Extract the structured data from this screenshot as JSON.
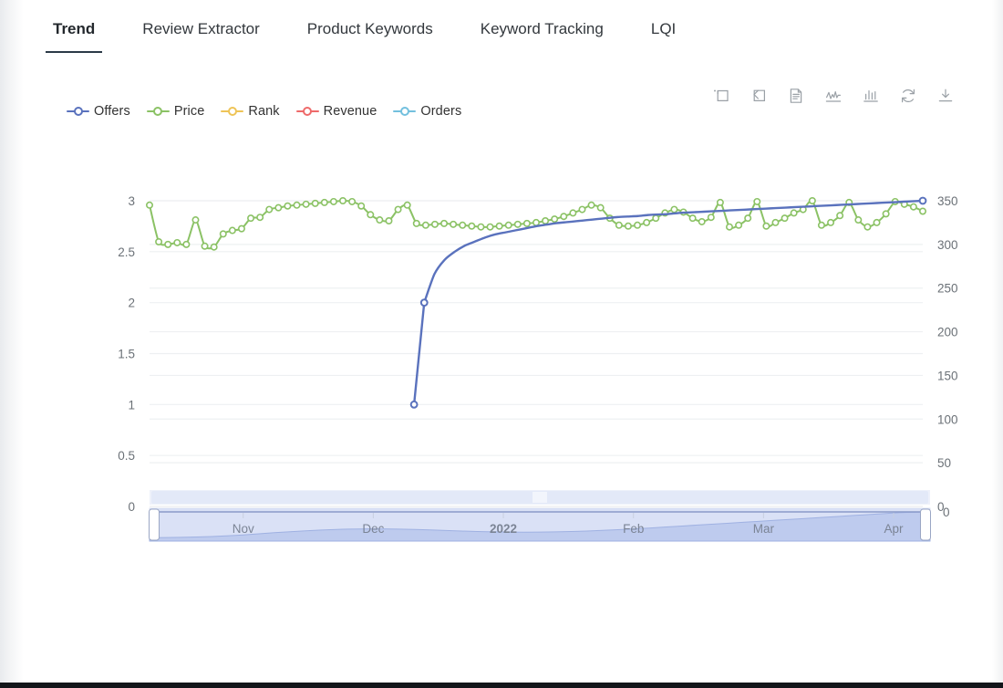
{
  "tabs": [
    {
      "label": "Trend",
      "active": true
    },
    {
      "label": "Review Extractor",
      "active": false
    },
    {
      "label": "Product Keywords",
      "active": false
    },
    {
      "label": "Keyword Tracking",
      "active": false
    },
    {
      "label": "LQI",
      "active": false
    }
  ],
  "toolbox": [
    {
      "name": "zoom-select-icon",
      "title": "Area zoom"
    },
    {
      "name": "undo-restore-icon",
      "title": "Restore zoom"
    },
    {
      "name": "data-view-icon",
      "title": "Data view"
    },
    {
      "name": "line-chart-icon",
      "title": "Switch to line chart"
    },
    {
      "name": "bar-chart-icon",
      "title": "Switch to bar chart"
    },
    {
      "name": "refresh-icon",
      "title": "Restore"
    },
    {
      "name": "download-icon",
      "title": "Save as image"
    }
  ],
  "colors": {
    "offers": "#5a72bd",
    "price": "#8bc265",
    "rank": "#eec457",
    "revenue": "#ee6a6a",
    "orders": "#73c0de",
    "grid": "#eef0f2",
    "axis_text": "#6b7177",
    "tab_active_underline": "#2b3a47",
    "navigator_fill": "#c8d3f0",
    "navigator_area": "#b7c4ea"
  },
  "chart_data": {
    "type": "line",
    "title": "",
    "xlabel": "",
    "legend": [
      "Offers",
      "Price",
      "Rank",
      "Revenue",
      "Orders"
    ],
    "legend_position": "top-left",
    "grid": true,
    "y_left": {
      "label": "",
      "ticks": [
        "0",
        "0.5",
        "1",
        "1.5",
        "2",
        "2.5",
        "3"
      ],
      "min": 0,
      "max": 3
    },
    "y_right": {
      "label": "",
      "ticks": [
        "0",
        "50",
        "100",
        "150",
        "200",
        "250",
        "300",
        "350"
      ],
      "min": 0,
      "max": 350
    },
    "x_tick_labels": [
      "Nov",
      "Dec",
      "2022",
      "Feb",
      "Mar",
      "Apr"
    ],
    "series": [
      {
        "name": "Offers",
        "axis": "left",
        "color": "#5a72bd",
        "values": [
          null,
          null,
          null,
          null,
          null,
          null,
          null,
          null,
          null,
          null,
          null,
          null,
          null,
          null,
          null,
          null,
          null,
          null,
          null,
          null,
          null,
          null,
          null,
          null,
          null,
          null,
          1.0,
          2.0,
          2.28,
          2.42,
          2.5,
          2.56,
          2.6,
          2.64,
          2.67,
          2.69,
          2.71,
          2.73,
          2.75,
          2.765,
          2.78,
          2.79,
          2.8,
          2.81,
          2.82,
          2.83,
          2.84,
          2.845,
          2.85,
          2.86,
          2.865,
          2.87,
          2.88,
          2.885,
          2.89,
          2.895,
          2.9,
          2.905,
          2.91,
          2.915,
          2.92,
          2.925,
          2.93,
          2.935,
          2.94,
          2.945,
          2.95,
          2.955,
          2.96,
          2.965,
          2.97,
          2.975,
          2.98,
          2.985,
          2.99,
          2.995,
          3.0
        ]
      },
      {
        "name": "Price",
        "axis": "right",
        "color": "#8bc265",
        "values": [
          345,
          303,
          300,
          302,
          300,
          328,
          298,
          297,
          312,
          316,
          318,
          330,
          331,
          340,
          342,
          344,
          345,
          346,
          347,
          348,
          349,
          350,
          349,
          344,
          334,
          328,
          327,
          340,
          345,
          324,
          322,
          323,
          324,
          323,
          322,
          321,
          320,
          320,
          321,
          322,
          323,
          324,
          325,
          327,
          329,
          332,
          336,
          340,
          345,
          342,
          330,
          322,
          321,
          322,
          325,
          330,
          336,
          340,
          337,
          330,
          326,
          331,
          348,
          320,
          322,
          330,
          349,
          321,
          325,
          330,
          336,
          340,
          350,
          322,
          325,
          333,
          348,
          328,
          320,
          325,
          335,
          349,
          346,
          343,
          338
        ]
      },
      {
        "name": "Rank",
        "axis": "right",
        "color": "#eec457",
        "values": []
      },
      {
        "name": "Revenue",
        "axis": "right",
        "color": "#ee6a6a",
        "values": []
      },
      {
        "name": "Orders",
        "axis": "right",
        "color": "#73c0de",
        "values": []
      }
    ],
    "navigator": {
      "visible": true,
      "range_start_pct": 0,
      "range_end_pct": 100,
      "tick_labels": [
        "Nov",
        "Dec",
        "2022",
        "Feb",
        "Mar",
        "Apr"
      ],
      "right_edge_value": "0"
    }
  }
}
